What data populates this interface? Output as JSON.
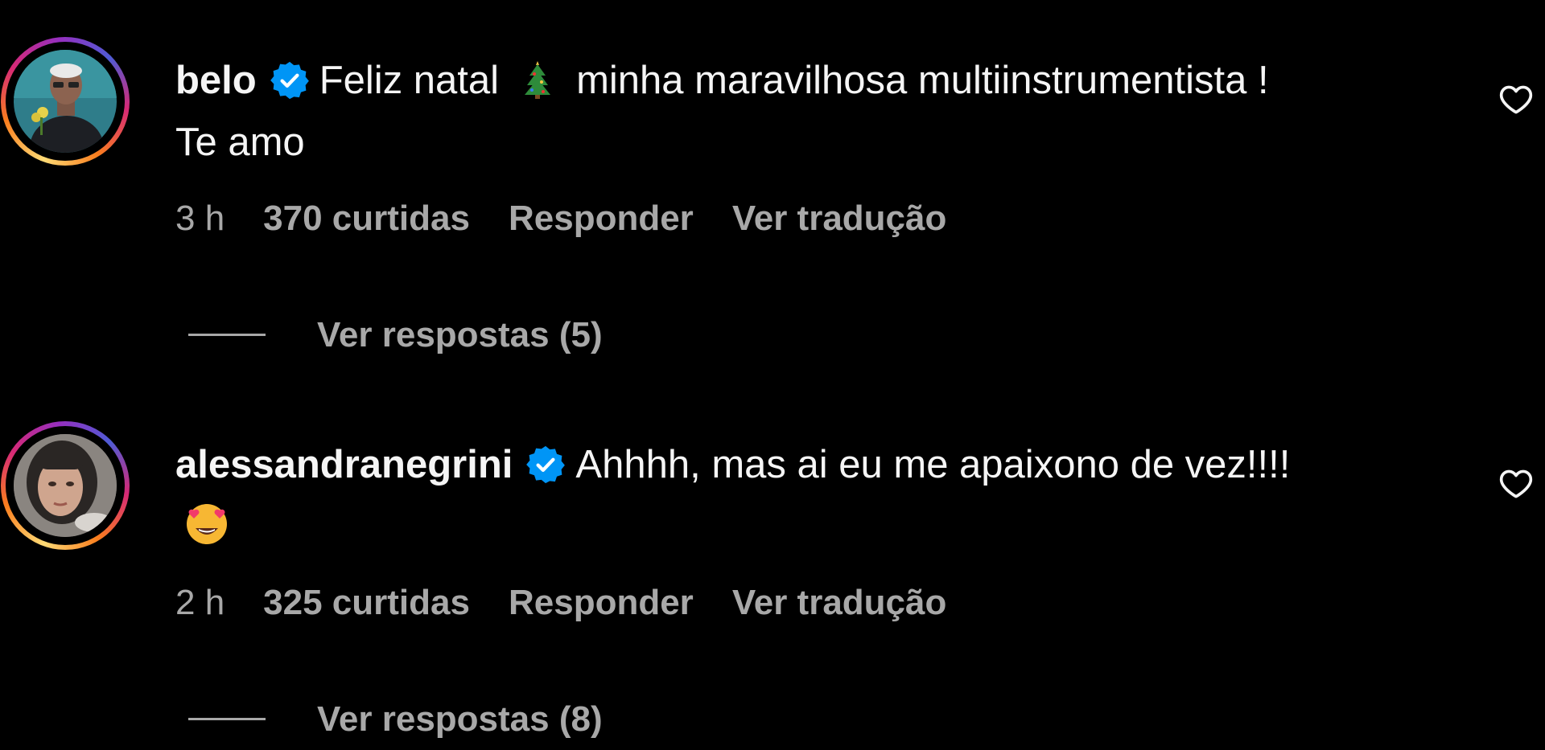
{
  "comments": [
    {
      "username": "belo",
      "verified": true,
      "text_part1": "Feliz natal",
      "emoji": "christmas-tree",
      "text_part2": "minha maravilhosa multiinstrumentista !",
      "text_line2": "Te amo",
      "time": "3 h",
      "likes": "370 curtidas",
      "reply_label": "Responder",
      "translate_label": "Ver tradução",
      "view_replies_label": "Ver respostas (5)"
    },
    {
      "username": "alessandranegrini",
      "verified": true,
      "text_part1": "Ahhhh, mas ai eu me apaixono de vez!!!!",
      "emoji": "heart-eyes",
      "time": "2 h",
      "likes": "325 curtidas",
      "reply_label": "Responder",
      "translate_label": "Ver tradução",
      "view_replies_label": "Ver respostas (8)"
    }
  ],
  "colors": {
    "background": "#000000",
    "text_primary": "#f5f5f5",
    "text_secondary": "#a8a8a8",
    "verified_blue": "#0095f6"
  }
}
